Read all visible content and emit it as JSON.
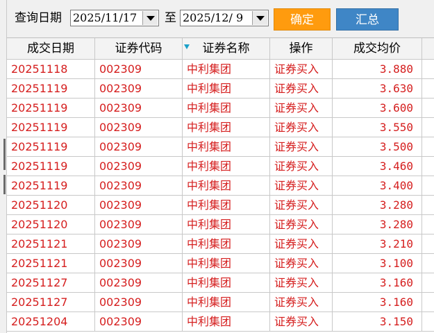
{
  "query": {
    "label": "查询日期",
    "start_date": "2025/11/17",
    "to_label": "至",
    "end_date": "2025/12/ 9",
    "confirm_label": "确定",
    "summary_label": "汇总"
  },
  "colors": {
    "row_text": "#d51e1e",
    "confirm_button": "#ff9b0e",
    "summary_button": "#3f86c6",
    "sort_indicator": "#1aa0c8"
  },
  "table": {
    "columns": [
      "成交日期",
      "证券代码",
      "证券名称",
      "操作",
      "成交均价"
    ],
    "rows": [
      [
        "20251118",
        "002309",
        "中利集团",
        "证券买入",
        "3.880"
      ],
      [
        "20251119",
        "002309",
        "中利集团",
        "证券买入",
        "3.630"
      ],
      [
        "20251119",
        "002309",
        "中利集团",
        "证券买入",
        "3.600"
      ],
      [
        "20251119",
        "002309",
        "中利集团",
        "证券买入",
        "3.550"
      ],
      [
        "20251119",
        "002309",
        "中利集团",
        "证券买入",
        "3.500"
      ],
      [
        "20251119",
        "002309",
        "中利集团",
        "证券买入",
        "3.460"
      ],
      [
        "20251119",
        "002309",
        "中利集团",
        "证券买入",
        "3.400"
      ],
      [
        "20251120",
        "002309",
        "中利集团",
        "证券买入",
        "3.280"
      ],
      [
        "20251120",
        "002309",
        "中利集团",
        "证券买入",
        "3.280"
      ],
      [
        "20251121",
        "002309",
        "中利集团",
        "证券买入",
        "3.210"
      ],
      [
        "20251121",
        "002309",
        "中利集团",
        "证券买入",
        "3.100"
      ],
      [
        "20251127",
        "002309",
        "中利集团",
        "证券买入",
        "3.160"
      ],
      [
        "20251127",
        "002309",
        "中利集团",
        "证券买入",
        "3.160"
      ],
      [
        "20251204",
        "002309",
        "中利集团",
        "证券买入",
        "3.150"
      ]
    ]
  }
}
